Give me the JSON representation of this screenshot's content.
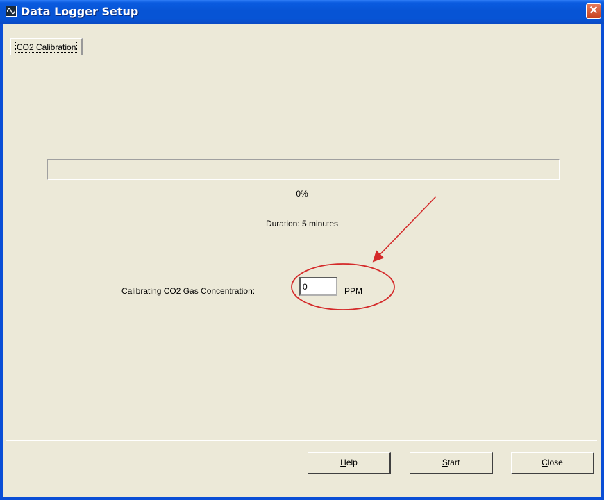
{
  "window": {
    "title": "Data Logger Setup",
    "close_glyph": "✕"
  },
  "tab": {
    "label": "CO2 Calibration"
  },
  "progress": {
    "value_fraction": 0,
    "percent_text": "0%",
    "fill_color": "#3c8f3c"
  },
  "duration_text": "Duration: 5 minutes",
  "concentration": {
    "label": "Calibrating CO2 Gas  Concentration:",
    "value": "0",
    "unit": "PPM"
  },
  "buttons": {
    "help": {
      "mnemonic": "H",
      "rest": "elp"
    },
    "start": {
      "mnemonic": "S",
      "rest": "tart"
    },
    "close": {
      "mnemonic": "C",
      "rest": "lose"
    }
  },
  "annotation": {
    "color": "#d42a2a",
    "shapes": [
      "arrow",
      "ellipse"
    ]
  },
  "colors": {
    "titlebar": "#0754d5",
    "window_bg": "#ece9d8",
    "close_button": "#c8431f"
  }
}
